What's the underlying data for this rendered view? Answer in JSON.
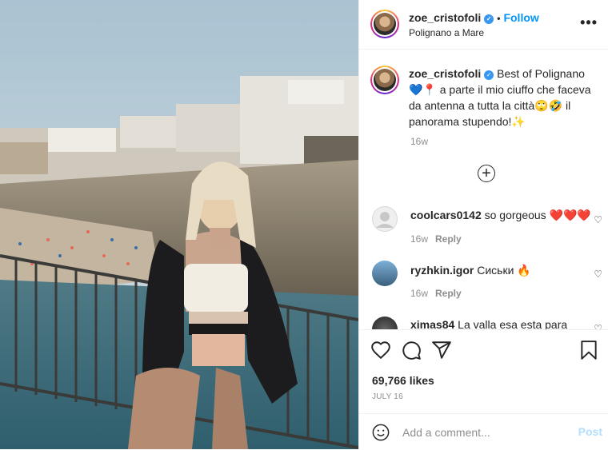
{
  "post": {
    "username": "zoe_cristofoli",
    "follow_label": "Follow",
    "dot": "•",
    "location": "Polignano a Mare",
    "more": "•••"
  },
  "caption": {
    "username": "zoe_cristofoli",
    "text": "Best of Polignano💙📍 a parte il mio ciuffo che faceva da antenna a tutta la città🙄🤣 il panorama stupendo!✨",
    "time": "16w"
  },
  "add_icon": "+",
  "comments": [
    {
      "username": "coolcars0142",
      "text": "so gorgeous ❤️❤️❤️",
      "time": "16w",
      "reply": "Reply",
      "avatar": "default-gray"
    },
    {
      "username": "ryzhkin.igor",
      "text": "Сиськи 🔥",
      "time": "16w",
      "reply": "Reply",
      "avatar": "photo-blue"
    },
    {
      "username": "ximas84",
      "text": "La valla esa esta para",
      "time": "",
      "reply": "",
      "avatar": "photo-dark"
    }
  ],
  "likes": "69,766 likes",
  "date": "JULY 16",
  "comment_box": {
    "placeholder": "Add a comment...",
    "post_label": "Post"
  },
  "colors": {
    "accent": "#0095f6",
    "post_disabled": "#b2dffc",
    "muted": "#8e8e8e",
    "heart": "#ed1e3d"
  }
}
